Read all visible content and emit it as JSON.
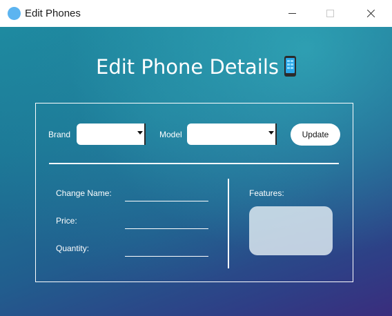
{
  "window": {
    "title": "Edit Phones",
    "controls": [
      "minimize",
      "maximize",
      "close"
    ]
  },
  "heading": {
    "text": "Edit Phone Details",
    "emoji_icon": "mobile-phone-icon"
  },
  "filters": {
    "brand_label": "Brand",
    "brand_value": "",
    "model_label": "Model",
    "model_value": "",
    "update_label": "Update"
  },
  "form": {
    "name_label": "Change Name:",
    "name_value": "",
    "price_label": "Price:",
    "price_value": "",
    "quantity_label": "Quantity:",
    "quantity_value": "",
    "features_label": "Features:",
    "features_value": ""
  },
  "colors": {
    "app_icon": "#5cb4f0",
    "background_top": "#1e8aa0",
    "background_bottom": "#3a2d7d",
    "frame_line": "#ffffff",
    "features_box": "#dce8f0"
  }
}
